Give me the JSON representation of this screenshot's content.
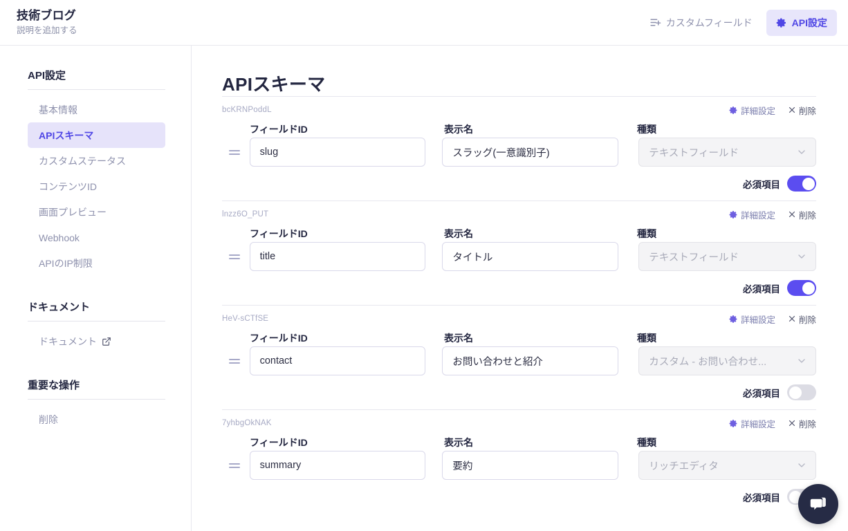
{
  "header": {
    "brand_title": "技術ブログ",
    "brand_subtitle": "説明を追加する",
    "custom_field_label": "カスタムフィールド",
    "custom_field_icon": "list-plus-icon",
    "api_settings_label": "API設定",
    "api_settings_icon": "gear-icon"
  },
  "sidebar": {
    "sections": [
      {
        "heading": "API設定",
        "items": [
          {
            "label": "基本情報",
            "active": false
          },
          {
            "label": "APIスキーマ",
            "active": true
          },
          {
            "label": "カスタムステータス",
            "active": false
          },
          {
            "label": "コンテンツID",
            "active": false
          },
          {
            "label": "画面プレビュー",
            "active": false
          },
          {
            "label": "Webhook",
            "active": false
          },
          {
            "label": "APIのIP制限",
            "active": false
          }
        ]
      },
      {
        "heading": "ドキュメント",
        "items": [
          {
            "label": "ドキュメント",
            "active": false,
            "icon": "external-link-icon"
          }
        ]
      },
      {
        "heading": "重要な操作",
        "items": [
          {
            "label": "削除",
            "active": false
          }
        ]
      }
    ]
  },
  "main": {
    "page_title": "APIスキーマ",
    "labels": {
      "field_id": "フィールドID",
      "display_name": "表示名",
      "type": "種類",
      "required": "必須項目"
    },
    "actions": {
      "detail_label": "詳細設定",
      "detail_icon": "gear-icon",
      "delete_label": "削除",
      "delete_icon": "close-icon"
    },
    "fields": [
      {
        "code": "bcKRNPoddL",
        "field_id": "slug",
        "display_name": "スラッグ(一意識別子)",
        "type": "テキストフィールド",
        "required": true
      },
      {
        "code": "lnzz6O_PUT",
        "field_id": "title",
        "display_name": "タイトル",
        "type": "テキストフィールド",
        "required": true
      },
      {
        "code": "HeV-sCTfSE",
        "field_id": "contact",
        "display_name": "お問い合わせと紹介",
        "type": "カスタム - お問い合わせ...",
        "required": false
      },
      {
        "code": "7yhbgOkNAK",
        "field_id": "summary",
        "display_name": "要約",
        "type": "リッチエディタ",
        "required": false
      }
    ]
  },
  "chat": {
    "icon": "chat-bubble-icon"
  },
  "colors": {
    "accent": "#4f46e5",
    "toggle_on": "#5b4df0",
    "active_bg": "#e6e3fa",
    "chat_fab": "#262b45"
  }
}
